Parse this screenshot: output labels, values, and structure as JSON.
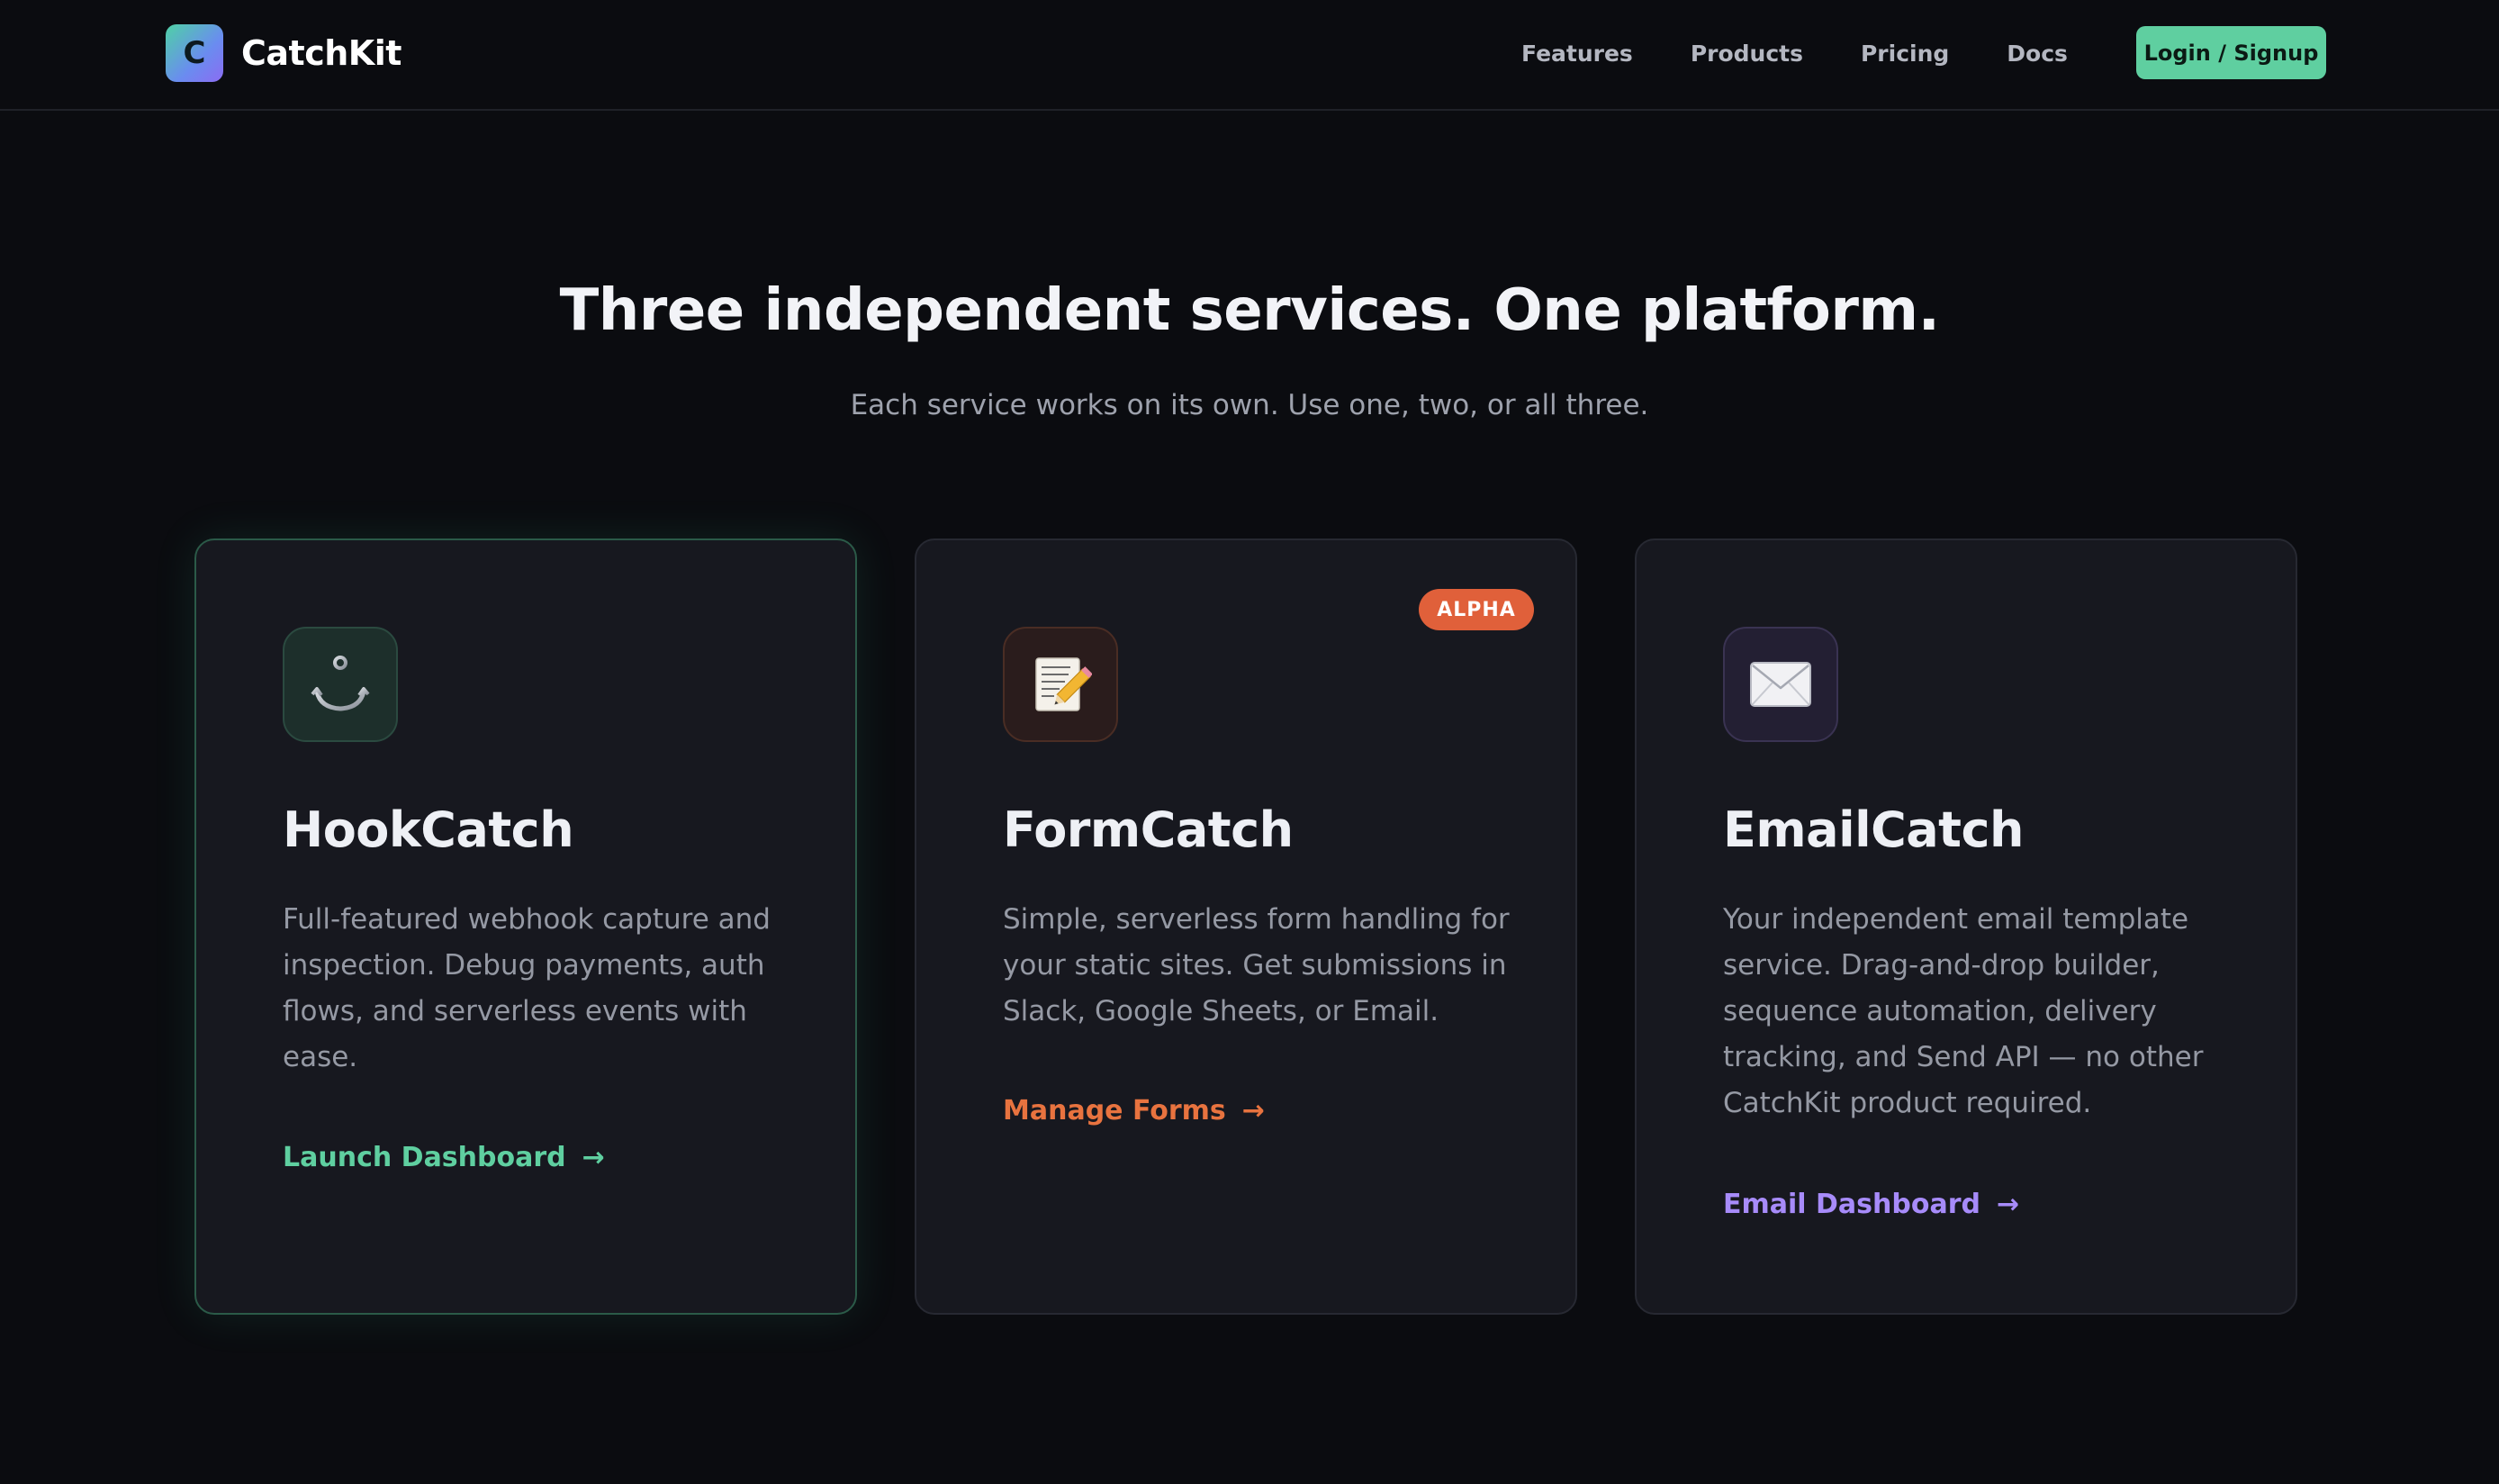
{
  "nav": {
    "logo_letter": "C",
    "brand": "CatchKit",
    "links": [
      {
        "label": "Features"
      },
      {
        "label": "Products"
      },
      {
        "label": "Pricing"
      },
      {
        "label": "Docs"
      }
    ],
    "login_label": "Login / Signup"
  },
  "hero": {
    "title": "Three independent services. One platform.",
    "subtitle": "Each service works on its own. Use one, two, or all three."
  },
  "cards": [
    {
      "icon": "anchor-icon",
      "title": "HookCatch",
      "description": "Full-featured webhook capture and inspection. Debug payments, auth flows, and serverless events with ease.",
      "link": "Launch Dashboard",
      "accent": "#5fcfa0"
    },
    {
      "icon": "memo-pencil-icon",
      "badge": "ALPHA",
      "title": "FormCatch",
      "description": "Simple, serverless form handling for your static sites. Get submissions in Slack, Google Sheets, or Email.",
      "link": "Manage Forms",
      "accent": "#e8733f"
    },
    {
      "icon": "envelope-icon",
      "title": "EmailCatch",
      "description": "Your independent email template service. Drag-and-drop builder, sequence automation, delivery tracking, and Send API — no other CatchKit product required.",
      "link": "Email Dashboard",
      "accent": "#a78bfa"
    }
  ],
  "arrow": "→"
}
